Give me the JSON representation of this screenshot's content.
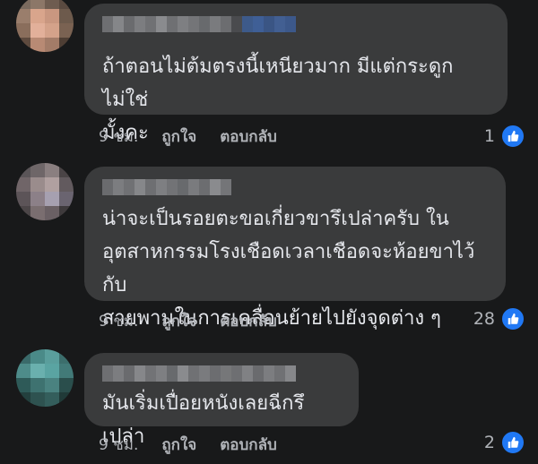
{
  "comments": [
    {
      "text": "ถ้าตอนไม่ต้มตรงนี้เหนียวมาก มีแต่กระดูกไม่ใช่\nมั้งคะ",
      "time": "9 ชม.",
      "like_label": "ถูกใจ",
      "reply_label": "ตอบกลับ",
      "reaction_count": "1",
      "reaction_icon": "like-icon",
      "accent": "#2078f4"
    },
    {
      "text": "น่าจะเป็นรอยตะขอเกี่ยวขารึเปล่าครับ ใน\nอุตสาหกรรมโรงเชือดเวลาเชือดจะห้อยขาไว้กับ\nสายพานในการเคลื่อนย้ายไปยังจุดต่าง ๆ",
      "time": "9 ชม.",
      "like_label": "ถูกใจ",
      "reply_label": "ตอบกลับ",
      "reaction_count": "28",
      "reaction_icon": "like-icon",
      "accent": "#2078f4"
    },
    {
      "text": "มันเริ่มเปื่อยหนังเลยฉีกรึเปล่า",
      "time": "9 ชม.",
      "like_label": "ถูกใจ",
      "reply_label": "ตอบกลับ",
      "reaction_count": "2",
      "reaction_icon": "like-icon",
      "accent": "#2078f4"
    }
  ]
}
